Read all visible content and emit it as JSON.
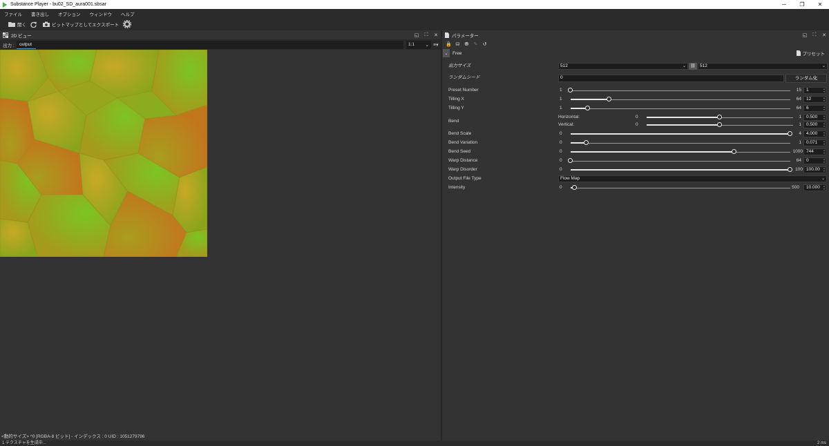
{
  "window": {
    "title": "Substance Player - bu02_SD_aura001.sbsar",
    "minimize": "─",
    "maximize": "❐",
    "close": "✕"
  },
  "menu": [
    "ファイル",
    "書き出し",
    "オプション",
    "ウィンドウ",
    "ヘルプ"
  ],
  "toolbar": {
    "open_label": "開く",
    "export_label": "ビットマップとしてエクスポート"
  },
  "view2d": {
    "title": "2D ビュー",
    "output_label": "出力 :",
    "output_tab": "output",
    "zoom": "1:1",
    "status_line": "<動的サイズ> ^0 [RGBA-8 ビット] - インデックス : 0 UID : 1051279796"
  },
  "params": {
    "title": "パラメーター",
    "group": "Free",
    "preset_label": "プリセット",
    "output_size": {
      "label": "出力サイズ",
      "x": "512",
      "y": "512"
    },
    "random_seed": {
      "label": "ランダムシード",
      "value": "0",
      "button": "ランダム化"
    },
    "sliders": [
      {
        "label": "Preset Number",
        "min": "1",
        "max": "15",
        "value": "1",
        "fraction": 0.0
      },
      {
        "label": "Tilling X",
        "min": "1",
        "max": "64",
        "value": "12",
        "fraction": 0.175
      },
      {
        "label": "Tilling Y",
        "min": "1",
        "max": "64",
        "value": "6",
        "fraction": 0.08
      },
      {
        "label": "Bend Scale",
        "min": "0",
        "max": "4",
        "value": "4.000",
        "fraction": 1.0
      },
      {
        "label": "Bend Variation",
        "min": "0",
        "max": "1",
        "value": "0.071",
        "fraction": 0.071
      },
      {
        "label": "Bend Seed",
        "min": "0",
        "max": "1000",
        "value": "744",
        "fraction": 0.744
      },
      {
        "label": "Warp Distance",
        "min": "0",
        "max": "64",
        "value": "0",
        "fraction": 0.0
      },
      {
        "label": "Warp Disorder",
        "min": "0",
        "max": "100",
        "value": "100.00",
        "fraction": 1.0
      }
    ],
    "bend": {
      "label": "Bend",
      "horizontal": {
        "label": "Horizontal:",
        "min": "0",
        "max": "1",
        "value": "0.500",
        "fraction": 0.5
      },
      "vertical": {
        "label": "Vertical:",
        "min": "0",
        "max": "1",
        "value": "0.500",
        "fraction": 0.5
      }
    },
    "output_file_type": {
      "label": "Output File Type",
      "value": "Flow Map"
    },
    "intensity": {
      "label": "Intensity",
      "min": "0",
      "max": "500",
      "value": "10.000",
      "fraction": 0.02
    }
  },
  "status": {
    "left": "1 テクスチャを生成中...",
    "right": "2 ms"
  }
}
